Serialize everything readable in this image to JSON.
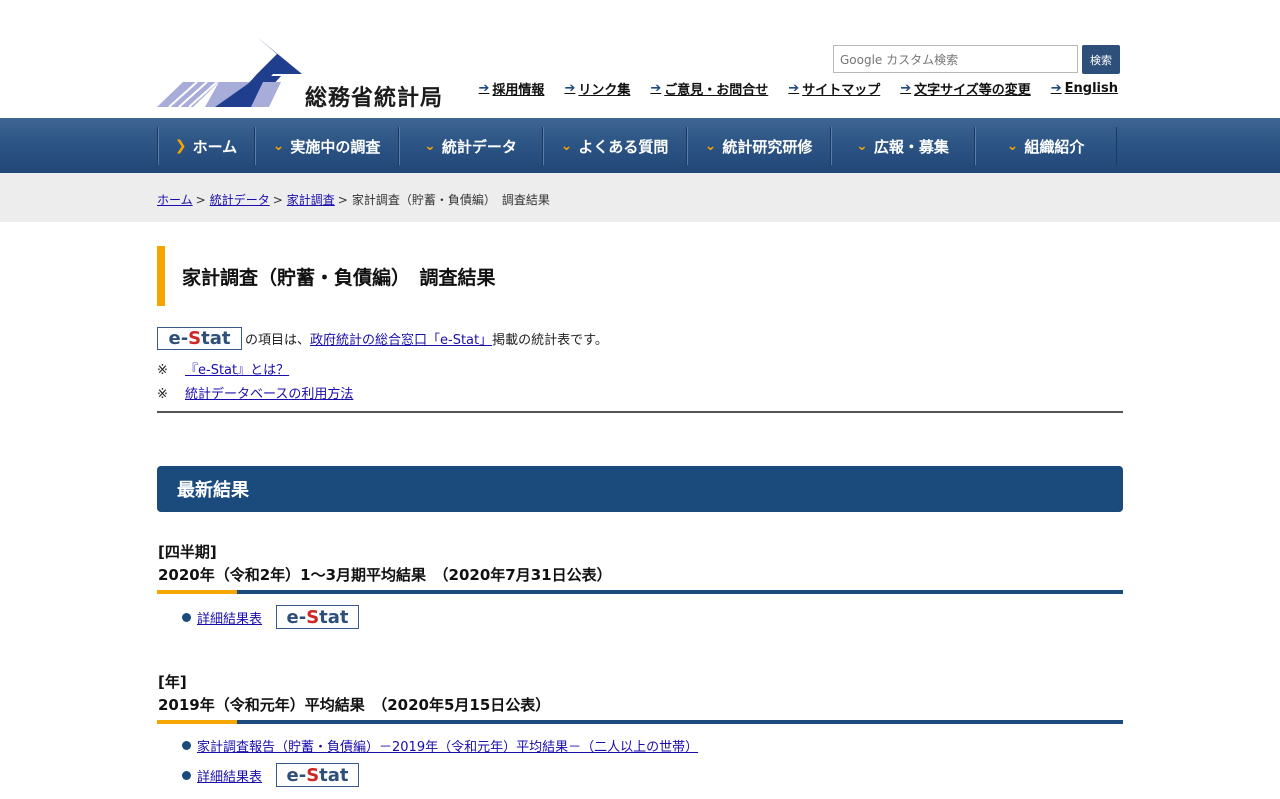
{
  "header": {
    "org_name": "総務省統計局",
    "search_placeholder": "カスタム検索",
    "search_brand": "Google",
    "search_button": "検索",
    "util_links": [
      "採用情報",
      "リンク集",
      "ご意見・お問合せ",
      "サイトマップ",
      "文字サイズ等の変更",
      "English"
    ]
  },
  "nav": {
    "items": [
      "ホーム",
      "実施中の調査",
      "統計データ",
      "よくある質問",
      "統計研究研修",
      "広報・募集",
      "組織紹介"
    ]
  },
  "breadcrumb": {
    "items": [
      "ホーム",
      "統計データ",
      "家計調査"
    ],
    "current": "家計調査（貯蓄・負債編）　調査結果",
    "separator": ">"
  },
  "page": {
    "title": "家計調査（貯蓄・負債編）　調査結果",
    "intro_prefix": "の項目は、",
    "intro_link": "政府統計の総合窓口「e-Stat」",
    "intro_suffix": "掲載の統計表です。",
    "note_mark": "※",
    "notes": [
      "『e-Stat』とは？",
      "統計データベースの利用方法"
    ]
  },
  "estat_badge": {
    "e": "e-",
    "s": "S",
    "rest": "tat"
  },
  "latest": {
    "heading": "最新結果",
    "blocks": [
      {
        "period": "[四半期]",
        "title": "2020年（令和2年）1～3月期平均結果　（2020年7月31日公表）",
        "links": [
          "詳細結果表"
        ]
      },
      {
        "period": "[年]",
        "title": "2019年（令和元年）平均結果　（2020年5月15日公表）",
        "links": [
          "家計調査報告（貯蓄・負債編）－2019年（令和元年）平均結果－（二人以上の世帯）",
          "詳細結果表"
        ]
      }
    ]
  },
  "colors": {
    "navy": "#1b4a7c",
    "accent": "#f4a500",
    "link": "#1a0dab"
  }
}
